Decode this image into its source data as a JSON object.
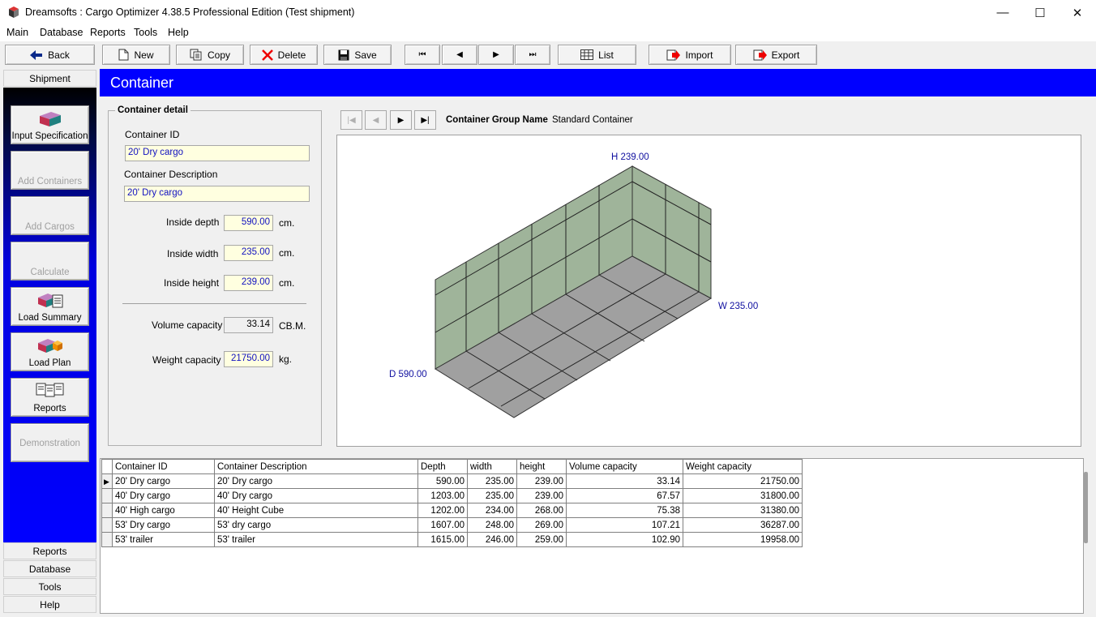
{
  "window": {
    "title": "Dreamsofts : Cargo Optimizer 4.38.5 Professional Edition  (Test shipment)",
    "minimize": "—",
    "maximize": "☐",
    "close": "✕"
  },
  "menu": [
    "Main",
    "Database",
    "Reports",
    "Tools",
    "Help"
  ],
  "toolbar": {
    "back": "Back",
    "new": "New",
    "copy": "Copy",
    "delete": "Delete",
    "save": "Save",
    "first": "⏮",
    "prev": "◀",
    "next": "▶",
    "last": "⏭",
    "list": "List",
    "import": "Import",
    "export": "Export"
  },
  "leftnav": {
    "header": "Shipment",
    "buttons": [
      "Input Specification",
      "Add Containers",
      "Add Cargos",
      "Calculate",
      "Load Summary",
      "Load Plan",
      "Reports",
      "Demonstration"
    ],
    "footer": [
      "Reports",
      "Database",
      "Tools",
      "Help"
    ]
  },
  "main": {
    "title": "Container"
  },
  "detail": {
    "legend": "Container detail",
    "id_label": "Container ID",
    "id_value": "20' Dry cargo",
    "desc_label": "Container Description",
    "desc_value": "20' Dry cargo",
    "depth_label": "Inside depth",
    "depth_value": "590.00",
    "width_label": "Inside width",
    "width_value": "235.00",
    "height_label": "Inside height",
    "height_value": "239.00",
    "unit_cm": "cm.",
    "volume_label": "Volume capacity",
    "volume_value": "33.14",
    "volume_unit": "CB.M.",
    "weight_label": "Weight capacity",
    "weight_value": "21750.00",
    "weight_unit": "kg."
  },
  "group": {
    "label": "Container Group Name",
    "value": "Standard Container"
  },
  "view3d": {
    "h_label": "H 239.00",
    "w_label": "W 235.00",
    "d_label": "D 590.00",
    "wall_color": "#9fb49a",
    "floor_color": "#a0a0a0"
  },
  "grid": {
    "columns": [
      "Container ID",
      "Container Description",
      "Depth",
      "width",
      "height",
      "Volume capacity",
      "Weight capacity"
    ],
    "rows": [
      [
        "20' Dry cargo",
        "20' Dry cargo",
        "590.00",
        "235.00",
        "239.00",
        "33.14",
        "21750.00"
      ],
      [
        "40' Dry cargo",
        "40' Dry cargo",
        "1203.00",
        "235.00",
        "239.00",
        "67.57",
        "31800.00"
      ],
      [
        "40' High cargo",
        "40' Height Cube",
        "1202.00",
        "234.00",
        "268.00",
        "75.38",
        "31380.00"
      ],
      [
        "53' Dry cargo",
        "53' dry cargo",
        "1607.00",
        "248.00",
        "269.00",
        "107.21",
        "36287.00"
      ],
      [
        "53' trailer",
        "53' trailer",
        "1615.00",
        "246.00",
        "259.00",
        "102.90",
        "19958.00"
      ]
    ]
  }
}
